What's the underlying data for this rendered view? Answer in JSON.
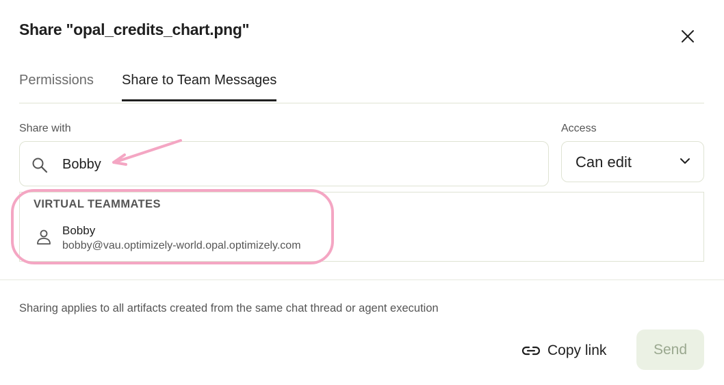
{
  "dialog": {
    "title": "Share \"opal_credits_chart.png\""
  },
  "tabs": [
    {
      "label": "Permissions",
      "active": false
    },
    {
      "label": "Share to Team Messages",
      "active": true
    }
  ],
  "share_with": {
    "label": "Share with",
    "value": "Bobby",
    "icon": "search-icon"
  },
  "access": {
    "label": "Access",
    "value": "Can edit",
    "icon": "chevron-down-icon"
  },
  "results": {
    "header": "VIRTUAL TEAMMATES",
    "items": [
      {
        "name": "Bobby",
        "email": "bobby@vau.optimizely-world.opal.optimizely.com",
        "icon": "person-icon"
      }
    ]
  },
  "footer": {
    "note": "Sharing applies to all artifacts created from the same chat thread or agent execution",
    "copy_link_label": "Copy link",
    "send_label": "Send"
  },
  "colors": {
    "annotation": "#f4a6c3",
    "border": "#dfe3d3",
    "send_bg": "#ebf1e4",
    "send_text": "#9aa88f"
  }
}
